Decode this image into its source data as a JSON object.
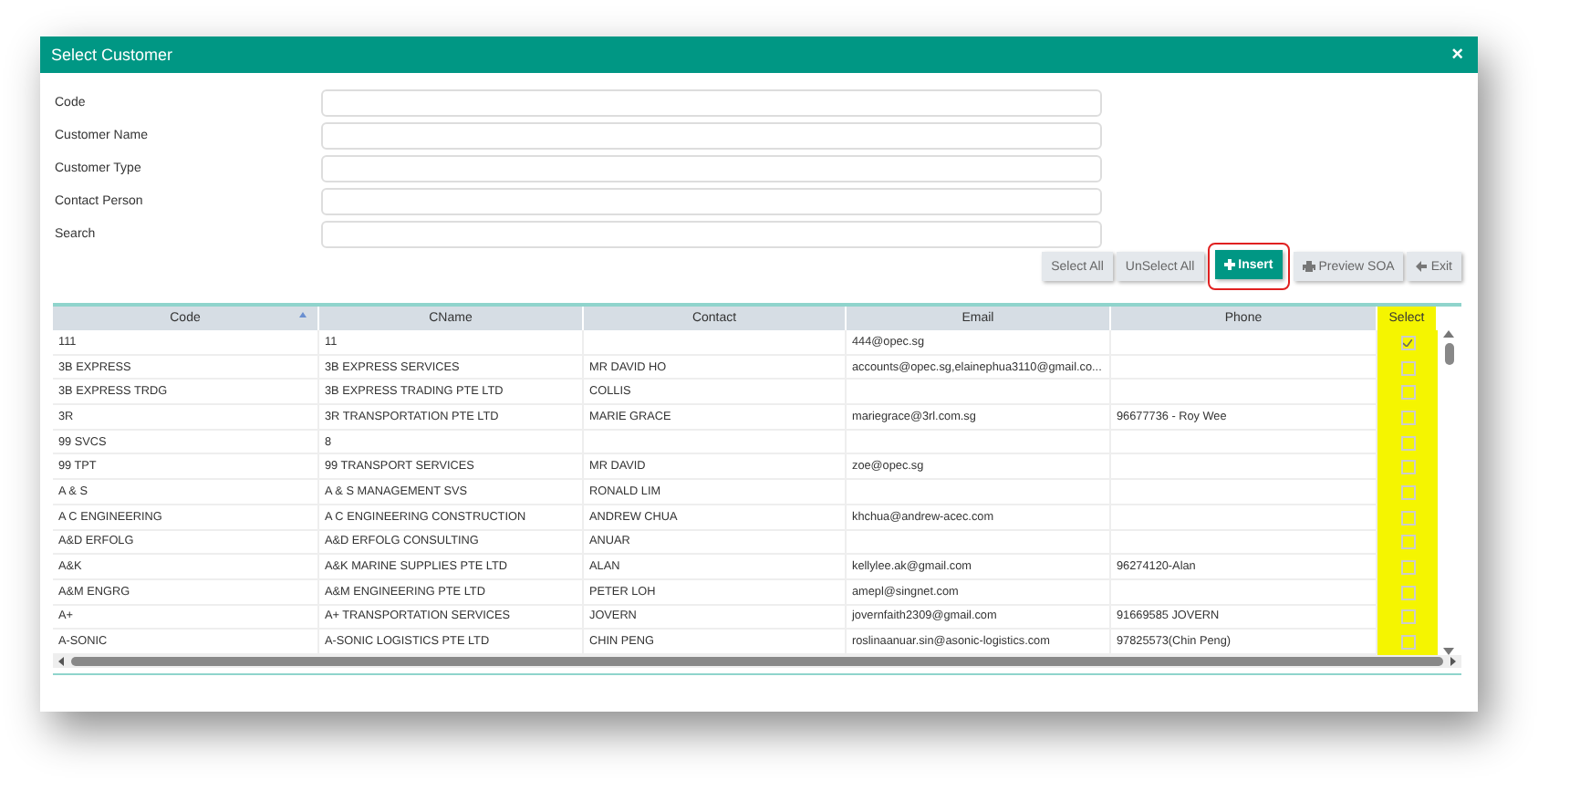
{
  "dialog": {
    "title": "Select Customer",
    "close": "×"
  },
  "fields": [
    {
      "label": "Code"
    },
    {
      "label": "Customer Name"
    },
    {
      "label": "Customer Type"
    },
    {
      "label": "Contact Person"
    },
    {
      "label": "Search"
    }
  ],
  "buttons": [
    {
      "label": "Select All",
      "kind": "plain",
      "highlighted": false
    },
    {
      "label": "UnSelect All",
      "kind": "plain",
      "highlighted": false
    },
    {
      "label": "Insert",
      "kind": "insert",
      "highlighted": true
    },
    {
      "label": "Preview SOA",
      "kind": "print",
      "highlighted": false
    },
    {
      "label": "Exit",
      "kind": "exit",
      "highlighted": false
    }
  ],
  "table": {
    "columns": [
      {
        "label": "Code",
        "sorted": true,
        "highlighted": false
      },
      {
        "label": "CName",
        "sorted": false,
        "highlighted": false
      },
      {
        "label": "Contact",
        "sorted": false,
        "highlighted": false
      },
      {
        "label": "Email",
        "sorted": false,
        "highlighted": false
      },
      {
        "label": "Phone",
        "sorted": false,
        "highlighted": false
      },
      {
        "label": "Select",
        "sorted": false,
        "highlighted": true
      }
    ],
    "rows": [
      {
        "cells": [
          "111",
          "11",
          "",
          "444@opec.sg",
          ""
        ],
        "checked": true
      },
      {
        "cells": [
          "3B EXPRESS",
          "3B EXPRESS SERVICES",
          "MR DAVID HO",
          "accounts@opec.sg,elainephua3110@gmail.co...",
          ""
        ],
        "checked": false
      },
      {
        "cells": [
          "3B EXPRESS TRDG",
          "3B EXPRESS TRADING PTE LTD",
          "COLLIS",
          "",
          ""
        ],
        "checked": false
      },
      {
        "cells": [
          "3R",
          "3R TRANSPORTATION PTE LTD",
          "MARIE GRACE",
          "mariegrace@3rl.com.sg",
          "96677736 - Roy Wee"
        ],
        "checked": false
      },
      {
        "cells": [
          "99 SVCS",
          "8",
          "",
          "",
          ""
        ],
        "checked": false
      },
      {
        "cells": [
          "99 TPT",
          "99 TRANSPORT SERVICES",
          "MR DAVID",
          "zoe@opec.sg",
          ""
        ],
        "checked": false
      },
      {
        "cells": [
          "A & S",
          "A & S MANAGEMENT SVS",
          "RONALD LIM",
          "",
          ""
        ],
        "checked": false
      },
      {
        "cells": [
          "A C ENGINEERING",
          "A C ENGINEERING CONSTRUCTION",
          "ANDREW CHUA",
          "khchua@andrew-acec.com",
          ""
        ],
        "checked": false
      },
      {
        "cells": [
          "A&D ERFOLG",
          "A&D ERFOLG CONSULTING",
          "ANUAR",
          "",
          ""
        ],
        "checked": false
      },
      {
        "cells": [
          "A&K",
          "A&K MARINE SUPPLIES PTE LTD",
          "ALAN",
          "kellylee.ak@gmail.com",
          "96274120-Alan"
        ],
        "checked": false
      },
      {
        "cells": [
          "A&M ENGRG",
          "A&M ENGINEERING PTE LTD",
          "PETER LOH",
          "amepl@singnet.com",
          ""
        ],
        "checked": false
      },
      {
        "cells": [
          "A+",
          "A+ TRANSPORTATION SERVICES",
          "JOVERN",
          "jovernfaith2309@gmail.com",
          "91669585 JOVERN"
        ],
        "checked": false
      },
      {
        "cells": [
          "A-SONIC",
          "A-SONIC LOGISTICS PTE LTD",
          "CHIN PENG",
          "roslinaanuar.sin@asonic-logistics.com",
          "97825573(Chin Peng)"
        ],
        "checked": false
      }
    ]
  }
}
